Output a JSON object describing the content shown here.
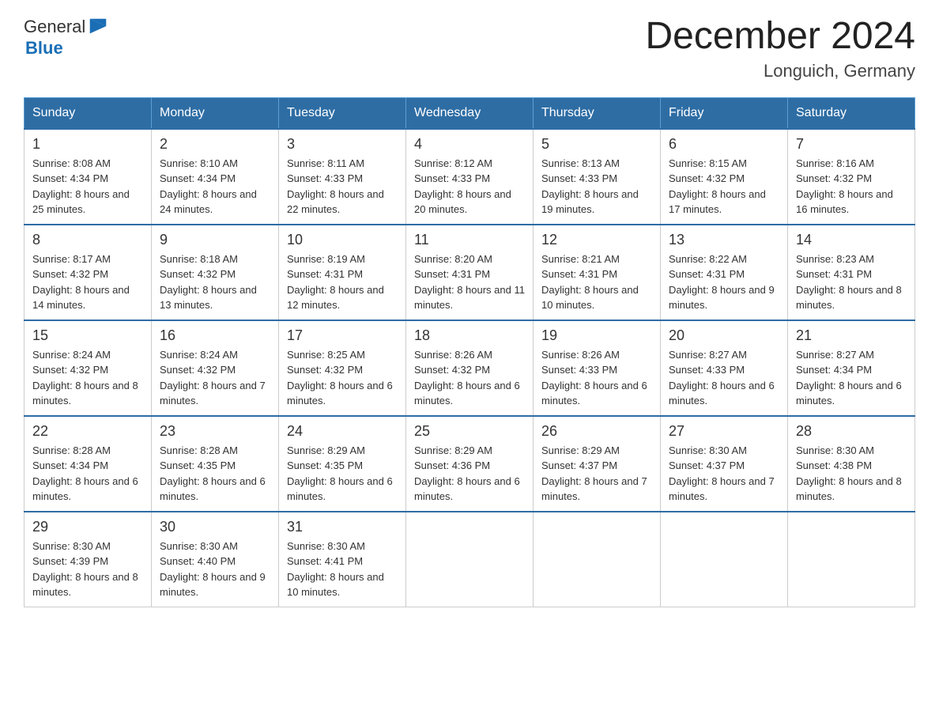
{
  "header": {
    "title": "December 2024",
    "location": "Longuich, Germany",
    "logo_general": "General",
    "logo_blue": "Blue"
  },
  "days_of_week": [
    "Sunday",
    "Monday",
    "Tuesday",
    "Wednesday",
    "Thursday",
    "Friday",
    "Saturday"
  ],
  "weeks": [
    [
      {
        "day": "1",
        "sunrise": "8:08 AM",
        "sunset": "4:34 PM",
        "daylight": "8 hours and 25 minutes."
      },
      {
        "day": "2",
        "sunrise": "8:10 AM",
        "sunset": "4:34 PM",
        "daylight": "8 hours and 24 minutes."
      },
      {
        "day": "3",
        "sunrise": "8:11 AM",
        "sunset": "4:33 PM",
        "daylight": "8 hours and 22 minutes."
      },
      {
        "day": "4",
        "sunrise": "8:12 AM",
        "sunset": "4:33 PM",
        "daylight": "8 hours and 20 minutes."
      },
      {
        "day": "5",
        "sunrise": "8:13 AM",
        "sunset": "4:33 PM",
        "daylight": "8 hours and 19 minutes."
      },
      {
        "day": "6",
        "sunrise": "8:15 AM",
        "sunset": "4:32 PM",
        "daylight": "8 hours and 17 minutes."
      },
      {
        "day": "7",
        "sunrise": "8:16 AM",
        "sunset": "4:32 PM",
        "daylight": "8 hours and 16 minutes."
      }
    ],
    [
      {
        "day": "8",
        "sunrise": "8:17 AM",
        "sunset": "4:32 PM",
        "daylight": "8 hours and 14 minutes."
      },
      {
        "day": "9",
        "sunrise": "8:18 AM",
        "sunset": "4:32 PM",
        "daylight": "8 hours and 13 minutes."
      },
      {
        "day": "10",
        "sunrise": "8:19 AM",
        "sunset": "4:31 PM",
        "daylight": "8 hours and 12 minutes."
      },
      {
        "day": "11",
        "sunrise": "8:20 AM",
        "sunset": "4:31 PM",
        "daylight": "8 hours and 11 minutes."
      },
      {
        "day": "12",
        "sunrise": "8:21 AM",
        "sunset": "4:31 PM",
        "daylight": "8 hours and 10 minutes."
      },
      {
        "day": "13",
        "sunrise": "8:22 AM",
        "sunset": "4:31 PM",
        "daylight": "8 hours and 9 minutes."
      },
      {
        "day": "14",
        "sunrise": "8:23 AM",
        "sunset": "4:31 PM",
        "daylight": "8 hours and 8 minutes."
      }
    ],
    [
      {
        "day": "15",
        "sunrise": "8:24 AM",
        "sunset": "4:32 PM",
        "daylight": "8 hours and 8 minutes."
      },
      {
        "day": "16",
        "sunrise": "8:24 AM",
        "sunset": "4:32 PM",
        "daylight": "8 hours and 7 minutes."
      },
      {
        "day": "17",
        "sunrise": "8:25 AM",
        "sunset": "4:32 PM",
        "daylight": "8 hours and 6 minutes."
      },
      {
        "day": "18",
        "sunrise": "8:26 AM",
        "sunset": "4:32 PM",
        "daylight": "8 hours and 6 minutes."
      },
      {
        "day": "19",
        "sunrise": "8:26 AM",
        "sunset": "4:33 PM",
        "daylight": "8 hours and 6 minutes."
      },
      {
        "day": "20",
        "sunrise": "8:27 AM",
        "sunset": "4:33 PM",
        "daylight": "8 hours and 6 minutes."
      },
      {
        "day": "21",
        "sunrise": "8:27 AM",
        "sunset": "4:34 PM",
        "daylight": "8 hours and 6 minutes."
      }
    ],
    [
      {
        "day": "22",
        "sunrise": "8:28 AM",
        "sunset": "4:34 PM",
        "daylight": "8 hours and 6 minutes."
      },
      {
        "day": "23",
        "sunrise": "8:28 AM",
        "sunset": "4:35 PM",
        "daylight": "8 hours and 6 minutes."
      },
      {
        "day": "24",
        "sunrise": "8:29 AM",
        "sunset": "4:35 PM",
        "daylight": "8 hours and 6 minutes."
      },
      {
        "day": "25",
        "sunrise": "8:29 AM",
        "sunset": "4:36 PM",
        "daylight": "8 hours and 6 minutes."
      },
      {
        "day": "26",
        "sunrise": "8:29 AM",
        "sunset": "4:37 PM",
        "daylight": "8 hours and 7 minutes."
      },
      {
        "day": "27",
        "sunrise": "8:30 AM",
        "sunset": "4:37 PM",
        "daylight": "8 hours and 7 minutes."
      },
      {
        "day": "28",
        "sunrise": "8:30 AM",
        "sunset": "4:38 PM",
        "daylight": "8 hours and 8 minutes."
      }
    ],
    [
      {
        "day": "29",
        "sunrise": "8:30 AM",
        "sunset": "4:39 PM",
        "daylight": "8 hours and 8 minutes."
      },
      {
        "day": "30",
        "sunrise": "8:30 AM",
        "sunset": "4:40 PM",
        "daylight": "8 hours and 9 minutes."
      },
      {
        "day": "31",
        "sunrise": "8:30 AM",
        "sunset": "4:41 PM",
        "daylight": "8 hours and 10 minutes."
      },
      null,
      null,
      null,
      null
    ]
  ]
}
